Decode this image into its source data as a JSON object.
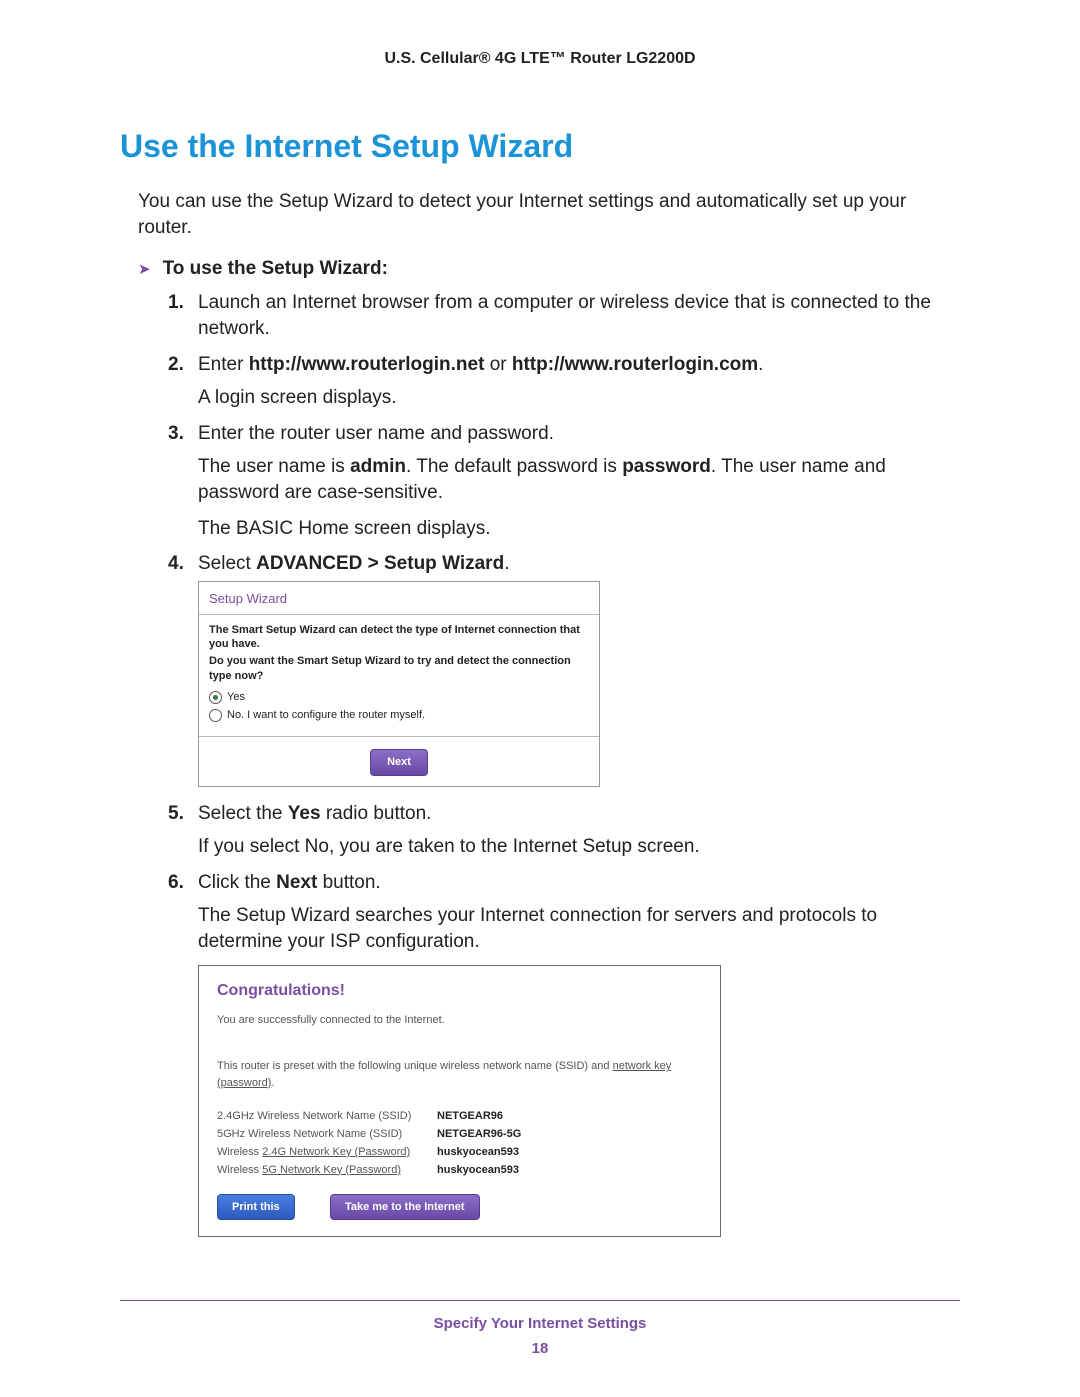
{
  "header": "U.S. Cellular® 4G LTE™ Router LG2200D",
  "title": "Use the Internet Setup Wizard",
  "intro": "You can use the Setup Wizard to detect your Internet settings and automatically set up your router.",
  "task_label": "To use the Setup Wizard:",
  "steps": {
    "s1": "Launch an Internet browser from a computer or wireless device that is connected to the network.",
    "s2_pre": "Enter ",
    "s2_b1": "http://www.routerlogin.net",
    "s2_mid": " or ",
    "s2_b2": "http://www.routerlogin.com",
    "s2_post": ".",
    "s2_p": "A login screen displays.",
    "s3": "Enter the router user name and password.",
    "s3_p1a": "The user name is ",
    "s3_p1b": "admin",
    "s3_p1c": ". The default password is ",
    "s3_p1d": "password",
    "s3_p1e": ". The user name and password are case-sensitive.",
    "s3_p2": "The BASIC Home screen displays.",
    "s4_pre": "Select ",
    "s4_b": "ADVANCED > Setup Wizard",
    "s4_post": ".",
    "s5_pre": "Select the ",
    "s5_b": "Yes",
    "s5_post": " radio button.",
    "s5_p": "If you select No, you are taken to the Internet Setup screen.",
    "s6_pre": "Click the ",
    "s6_b": "Next",
    "s6_post": " button.",
    "s6_p": "The Setup Wizard searches your Internet connection for servers and protocols to determine your ISP configuration."
  },
  "wizard": {
    "title": "Setup Wizard",
    "q1": "The Smart Setup Wizard can detect the type of Internet connection that you have.",
    "q2": "Do you want the Smart Setup Wizard to try and detect the connection type now?",
    "opt_yes": "Yes",
    "opt_no": "No. I want to configure the router myself.",
    "next": "Next"
  },
  "congrats": {
    "title": "Congratulations!",
    "sub": "You are successfully connected to the Internet.",
    "preset_a": "This router is preset with the following unique wireless network name (SSID) and ",
    "preset_link": "network key (password)",
    "preset_b": ".",
    "rows": [
      {
        "k": "2.4GHz Wireless Network Name (SSID)",
        "ul": "",
        "v": "NETGEAR96"
      },
      {
        "k": "5GHz Wireless Network Name (SSID)",
        "ul": "",
        "v": "NETGEAR96-5G"
      },
      {
        "k": "Wireless ",
        "ul": "2.4G Network Key (Password)",
        "v": "huskyocean593"
      },
      {
        "k": "Wireless ",
        "ul": "5G Network Key (Password)",
        "v": "huskyocean593"
      }
    ],
    "btn_print": "Print this",
    "btn_go": "Take me to the Internet"
  },
  "footer": {
    "chapter": "Specify Your Internet Settings",
    "page": "18"
  }
}
